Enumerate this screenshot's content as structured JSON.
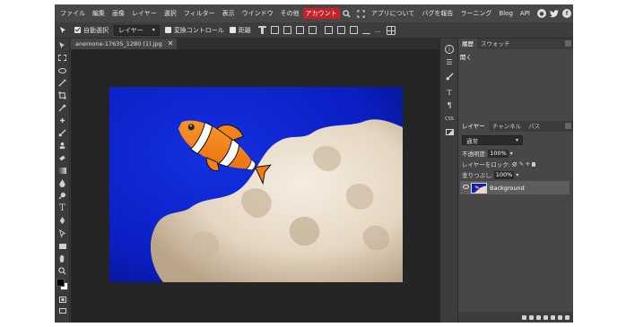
{
  "menubar": {
    "items": [
      "ファイル",
      "編集",
      "画像",
      "レイヤー",
      "選択",
      "フィルター",
      "表示",
      "ウインドウ",
      "その他"
    ],
    "account": "アカウント",
    "right_links": [
      "アプリについて",
      "バグを報告",
      "ラーニング",
      "Blog",
      "API"
    ],
    "social_icons": [
      "reddit-icon",
      "twitter-icon",
      "facebook-icon"
    ]
  },
  "options": {
    "auto_select_label": "自動選択",
    "auto_select_checked": true,
    "target_select": "レイヤー",
    "transform_label": "変換コントロール",
    "transform_checked": false,
    "distance_label": "距離",
    "distance_checked": false,
    "more": "..."
  },
  "document": {
    "tab_name": "anemone-17635_1280 (1).jpg"
  },
  "right_strip": {
    "icons": [
      "info-icon",
      "menu-icon",
      "brush-settings-icon",
      "paragraph-text-icon",
      "paragraph-icon",
      "css-label-icon",
      "image-icon"
    ],
    "css_label": "CSS"
  },
  "history": {
    "tabs": [
      "履歴",
      "スウォッチ"
    ],
    "active_tab": 0,
    "items": [
      "開く"
    ]
  },
  "layers": {
    "tabs": [
      "レイヤー",
      "チャンネル",
      "パス"
    ],
    "active_tab": 0,
    "blend_mode": "通常",
    "opacity_label": "不透明度:",
    "opacity_value": "100%",
    "lock_label": "レイヤーをロック:",
    "fill_label": "塗りつぶし:",
    "fill_value": "100%",
    "layer_name": "Background"
  },
  "colors": {
    "accent": "#c8202a",
    "ocean": "#0a1fc8",
    "fish_orange": "#f7841e"
  }
}
